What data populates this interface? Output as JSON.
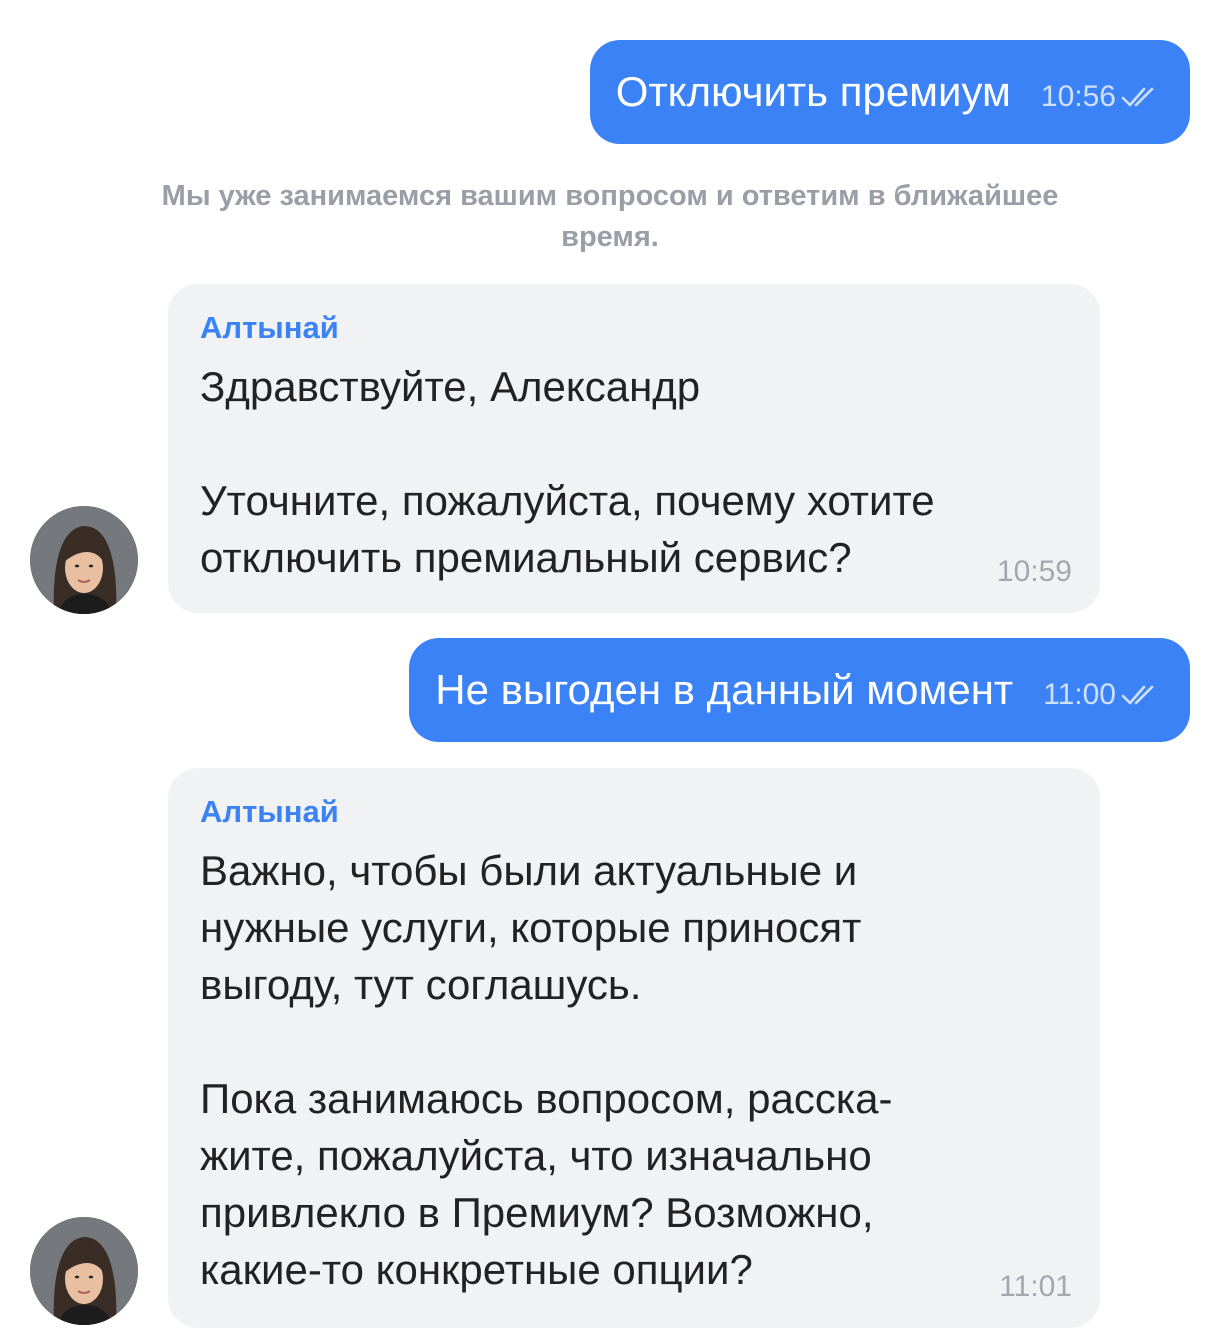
{
  "colors": {
    "outgoing_bubble": "#3b82f6",
    "incoming_bubble": "#f1f2f4",
    "sender_name": "#3b82f6",
    "system_text": "#9a9ea6"
  },
  "messages": [
    {
      "direction": "outgoing",
      "text": "Отключить премиум",
      "time": "10:56",
      "status_icon": "double-check-icon"
    },
    {
      "direction": "system",
      "text": "Мы уже занимаемся вашим вопросом и ответим в ближайшее время."
    },
    {
      "direction": "incoming",
      "sender": "Алтынай",
      "paragraphs": [
        "Здравствуйте, Александр",
        "Уточните, пожалуйста, почему хотите отключить премиальный сервис?"
      ],
      "time": "10:59"
    },
    {
      "direction": "outgoing",
      "text": "Не выгоден в данный момент",
      "time": "11:00",
      "status_icon": "double-check-icon"
    },
    {
      "direction": "incoming",
      "sender": "Алтынай",
      "paragraphs": [
        "Важно, чтобы были актуальные и нужные услуги, которые приносят выгоду, тут соглашусь.",
        "Пока занимаюсь вопросом, расска­жите, пожалуйста, что изначально привлекло в Премиум? Возможно, какие-то конкретные опции?"
      ],
      "time": "11:01"
    }
  ]
}
